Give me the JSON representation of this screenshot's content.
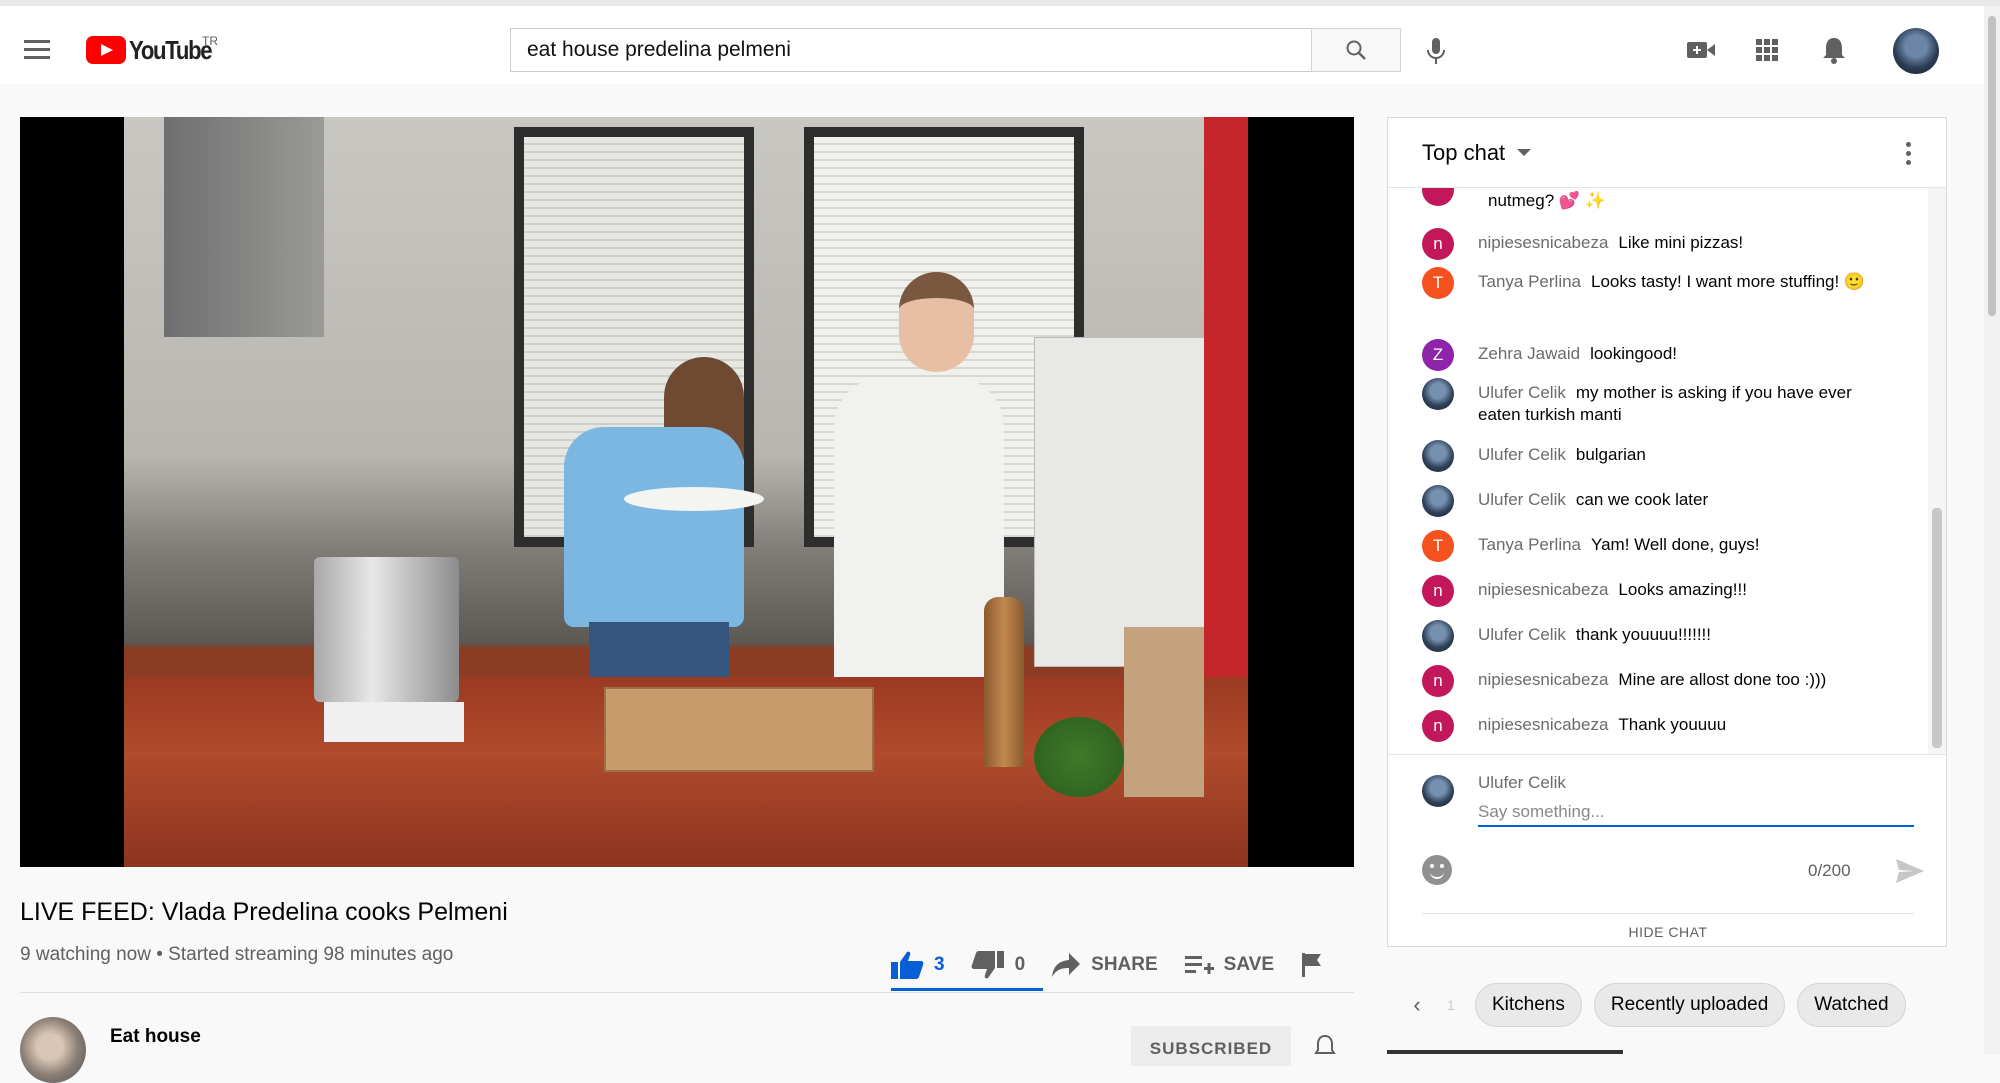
{
  "header": {
    "logo_text": "YouTube",
    "region": "TR",
    "search_value": "eat house predelina pelmeni",
    "icons": [
      "menu-icon",
      "search-icon",
      "microphone-icon",
      "create-video-icon",
      "apps-grid-icon",
      "notifications-bell-icon",
      "account-avatar"
    ]
  },
  "video": {
    "title": "LIVE FEED: Vlada Predelina cooks Pelmeni",
    "meta": "9 watching now • Started streaming 98 minutes ago",
    "likes": "3",
    "dislikes": "0",
    "share_label": "SHARE",
    "save_label": "SAVE"
  },
  "channel": {
    "name": "Eat house",
    "subscribe_label": "SUBSCRIBED"
  },
  "chat": {
    "header_label": "Top chat",
    "messages": [
      {
        "author": "",
        "text": "nutmeg? 💕 ✨",
        "avatar_letter": "",
        "avatar_color": "#c2185b"
      },
      {
        "author": "nipiesesnicabeza",
        "text": "Like mini pizzas!",
        "avatar_letter": "n",
        "avatar_color": "#c2185b"
      },
      {
        "author": "Tanya Perlina",
        "text": "Looks tasty! I want more stuffing! 🙂",
        "avatar_letter": "T",
        "avatar_color": "#f4511e"
      },
      {
        "author": "Zehra Jawaid",
        "text": "lookingood!",
        "avatar_letter": "Z",
        "avatar_color": "#8e24aa"
      },
      {
        "author": "Ulufer Celik",
        "text": "my mother is asking if you have ever eaten turkish manti",
        "avatar_letter": "",
        "avatar_color": "photo"
      },
      {
        "author": "Ulufer Celik",
        "text": "bulgarian",
        "avatar_letter": "",
        "avatar_color": "photo"
      },
      {
        "author": "Ulufer Celik",
        "text": "can we cook later",
        "avatar_letter": "",
        "avatar_color": "photo"
      },
      {
        "author": "Tanya Perlina",
        "text": "Yam! Well done, guys!",
        "avatar_letter": "T",
        "avatar_color": "#f4511e"
      },
      {
        "author": "nipiesesnicabeza",
        "text": "Looks amazing!!!",
        "avatar_letter": "n",
        "avatar_color": "#c2185b"
      },
      {
        "author": "Ulufer Celik",
        "text": "thank youuuu!!!!!!!",
        "avatar_letter": "",
        "avatar_color": "photo"
      },
      {
        "author": "nipiesesnicabeza",
        "text": "Mine are allost done too :)))",
        "avatar_letter": "n",
        "avatar_color": "#c2185b"
      },
      {
        "author": "nipiesesnicabeza",
        "text": "Thank youuuu",
        "avatar_letter": "n",
        "avatar_color": "#c2185b"
      }
    ],
    "input": {
      "user": "Ulufer Celik",
      "placeholder": "Say something...",
      "counter": "0/200"
    },
    "hide_label": "HIDE CHAT"
  },
  "chips": [
    "Kitchens",
    "Recently uploaded",
    "Watched"
  ],
  "colors": {
    "accent_blue": "#065fd4",
    "youtube_red": "#ff0000"
  }
}
